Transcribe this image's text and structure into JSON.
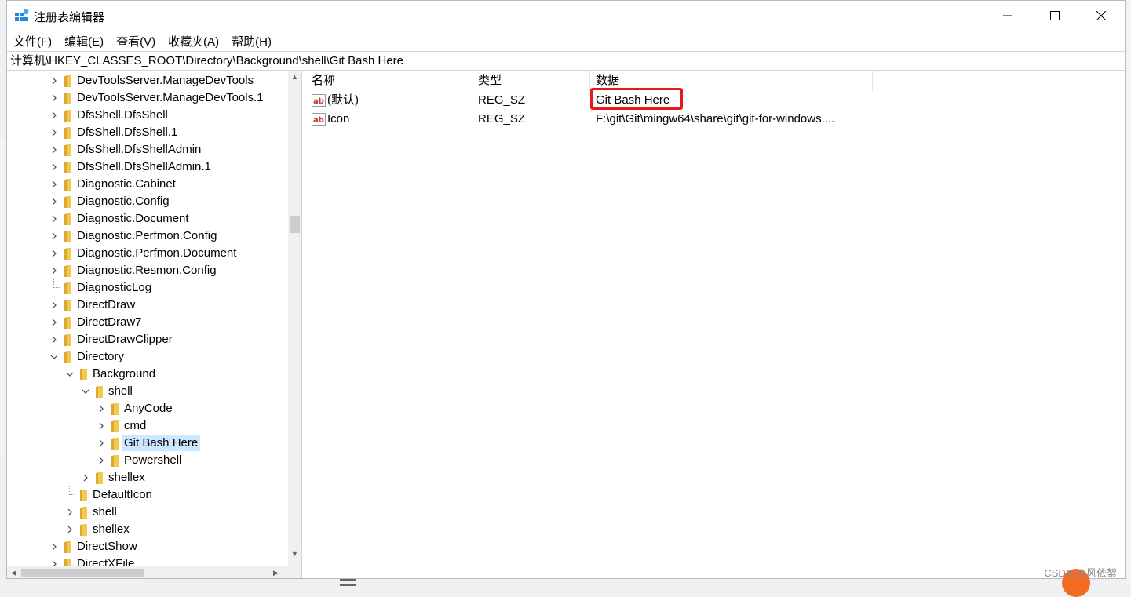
{
  "window": {
    "title": "注册表编辑器",
    "controls": {
      "minimize": "—",
      "maximize": "☐",
      "close": "✕"
    }
  },
  "menu": [
    "文件(F)",
    "编辑(E)",
    "查看(V)",
    "收藏夹(A)",
    "帮助(H)"
  ],
  "address": "计算机\\HKEY_CLASSES_ROOT\\Directory\\Background\\shell\\Git Bash Here",
  "tree": {
    "items": [
      {
        "label": "DevToolsServer.ManageDevTools",
        "depth": 0,
        "expander": "collapsed"
      },
      {
        "label": "DevToolsServer.ManageDevTools.1",
        "depth": 0,
        "expander": "collapsed"
      },
      {
        "label": "DfsShell.DfsShell",
        "depth": 0,
        "expander": "collapsed"
      },
      {
        "label": "DfsShell.DfsShell.1",
        "depth": 0,
        "expander": "collapsed"
      },
      {
        "label": "DfsShell.DfsShellAdmin",
        "depth": 0,
        "expander": "collapsed"
      },
      {
        "label": "DfsShell.DfsShellAdmin.1",
        "depth": 0,
        "expander": "collapsed"
      },
      {
        "label": "Diagnostic.Cabinet",
        "depth": 0,
        "expander": "collapsed"
      },
      {
        "label": "Diagnostic.Config",
        "depth": 0,
        "expander": "collapsed"
      },
      {
        "label": "Diagnostic.Document",
        "depth": 0,
        "expander": "collapsed"
      },
      {
        "label": "Diagnostic.Perfmon.Config",
        "depth": 0,
        "expander": "collapsed"
      },
      {
        "label": "Diagnostic.Perfmon.Document",
        "depth": 0,
        "expander": "collapsed"
      },
      {
        "label": "Diagnostic.Resmon.Config",
        "depth": 0,
        "expander": "collapsed"
      },
      {
        "label": "DiagnosticLog",
        "depth": 0,
        "expander": "none"
      },
      {
        "label": "DirectDraw",
        "depth": 0,
        "expander": "collapsed"
      },
      {
        "label": "DirectDraw7",
        "depth": 0,
        "expander": "collapsed"
      },
      {
        "label": "DirectDrawClipper",
        "depth": 0,
        "expander": "collapsed"
      },
      {
        "label": "Directory",
        "depth": 0,
        "expander": "expanded"
      },
      {
        "label": "Background",
        "depth": 1,
        "expander": "expanded"
      },
      {
        "label": "shell",
        "depth": 2,
        "expander": "expanded"
      },
      {
        "label": "AnyCode",
        "depth": 3,
        "expander": "collapsed"
      },
      {
        "label": "cmd",
        "depth": 3,
        "expander": "collapsed"
      },
      {
        "label": "Git Bash Here",
        "depth": 3,
        "expander": "collapsed",
        "selected": true
      },
      {
        "label": "Powershell",
        "depth": 3,
        "expander": "collapsed"
      },
      {
        "label": "shellex",
        "depth": 2,
        "expander": "collapsed"
      },
      {
        "label": "DefaultIcon",
        "depth": 1,
        "expander": "none"
      },
      {
        "label": "shell",
        "depth": 1,
        "expander": "collapsed"
      },
      {
        "label": "shellex",
        "depth": 1,
        "expander": "collapsed"
      },
      {
        "label": "DirectShow",
        "depth": 0,
        "expander": "collapsed"
      },
      {
        "label": "DirectXFile",
        "depth": 0,
        "expander": "collapsed"
      }
    ]
  },
  "values": {
    "columns": {
      "name": "名称",
      "type": "类型",
      "data": "数据"
    },
    "rows": [
      {
        "name": "(默认)",
        "type": "REG_SZ",
        "data": "Git Bash Here",
        "icon": "string-value-icon"
      },
      {
        "name": "Icon",
        "type": "REG_SZ",
        "data": "F:\\git\\Git\\mingw64\\share\\git\\git-for-windows....",
        "icon": "string-value-icon"
      }
    ]
  },
  "background": {
    "watermark": "CSDN @风依絮"
  },
  "colors": {
    "selection": "#cce8ff",
    "highlight_border": "#e81818",
    "folder": "#f2c94c",
    "app_icon": "#1e88e5"
  }
}
